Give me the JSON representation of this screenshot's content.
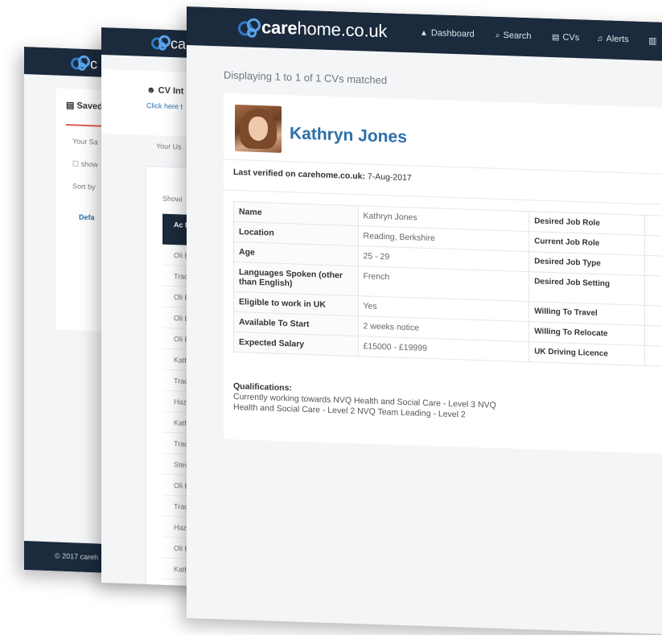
{
  "brand": {
    "name_bold": "care",
    "name_rest": "home.co.uk"
  },
  "nav": [
    {
      "icon": "dashboard-icon",
      "glyph": "▲",
      "label": "Dashboard"
    },
    {
      "icon": "search-icon",
      "glyph": "⌕",
      "label": "Search"
    },
    {
      "icon": "document-icon",
      "glyph": "▤",
      "label": "CVs"
    },
    {
      "icon": "bell-icon",
      "glyph": "♫",
      "label": "Alerts"
    }
  ],
  "back_page": {
    "card_title": "Saved",
    "lines": [
      "Your Sa",
      "show",
      "Sort by",
      "Defa"
    ],
    "footer": "© 2017 careh"
  },
  "mid_page": {
    "title": "CV Int",
    "link": "Click here t",
    "tab": "Your Us",
    "show": "Showi",
    "col_header": "Ac Na",
    "rows": [
      "Oli E",
      "Trac",
      "Oli E",
      "Oli E",
      "Oli E",
      "Kath",
      "Trac",
      "Haz",
      "Kath",
      "Trac",
      "Stev",
      "Oli E",
      "Trac",
      "Haz",
      "Oli E",
      "Kath"
    ]
  },
  "cv": {
    "displaying": "Displaying 1 to 1 of 1 CVs matched",
    "name": "Kathryn Jones",
    "verified_label": "Last verified on carehome.co.uk:",
    "verified_date": "7-Aug-2017",
    "rows": [
      {
        "k": "Name",
        "v": "Kathryn Jones",
        "k2": "Desired Job Role"
      },
      {
        "k": "Location",
        "v": "Reading, Berkshire",
        "k2": "Current Job Role"
      },
      {
        "k": "Age",
        "v": "25 - 29",
        "k2": "Desired Job Type"
      },
      {
        "k": "Languages Spoken (other than English)",
        "v": "French",
        "k2": "Desired Job Setting"
      },
      {
        "k": "Eligible to work in UK",
        "v": "Yes",
        "k2": "Willing To Travel"
      },
      {
        "k": "Available To Start",
        "v": "2 weeks notice",
        "k2": "Willing To Relocate"
      },
      {
        "k": "Expected Salary",
        "v": "£15000 - £19999",
        "k2": "UK Driving Licence"
      }
    ],
    "qualifications_title": "Qualifications:",
    "qualifications": [
      "Currently working towards NVQ Health and Social Care - Level 3 NVQ",
      "Health and Social Care - Level 2 NVQ Team Leading - Level 2"
    ]
  },
  "colors": {
    "navbar": "#1b2a3c",
    "accent": "#2d6fa8",
    "logo": "#5aa3e8"
  }
}
